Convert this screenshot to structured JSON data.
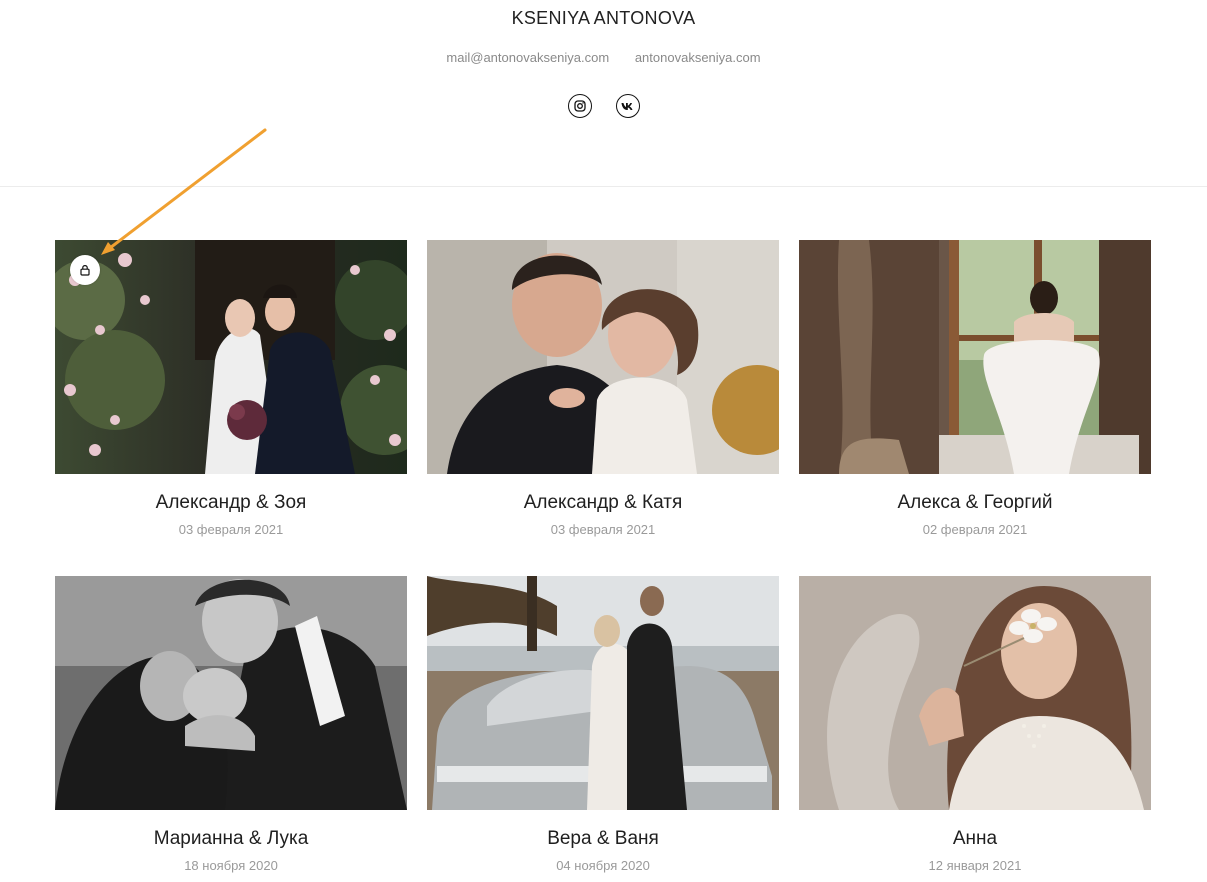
{
  "header": {
    "title": "KSENIYA ANTONOVA",
    "email": "mail@antonovakseniya.com",
    "website": "antonovakseniya.com",
    "socials": [
      {
        "icon": "instagram-icon"
      },
      {
        "icon": "vk-icon"
      }
    ]
  },
  "annotation": {
    "color": "#f0a030"
  },
  "gallery": {
    "items": [
      {
        "title": "Александр & Зоя",
        "date": "03 февраля 2021",
        "locked": true
      },
      {
        "title": "Александр & Катя",
        "date": "03 февраля 2021",
        "locked": false
      },
      {
        "title": "Алекса & Георгий",
        "date": "02 февраля 2021",
        "locked": false
      },
      {
        "title": "Марианна & Лука",
        "date": "18 ноября 2020",
        "locked": false
      },
      {
        "title": "Вера & Ваня",
        "date": "04 ноября 2020",
        "locked": false
      },
      {
        "title": "Анна",
        "date": "12 января 2021",
        "locked": false
      }
    ]
  }
}
